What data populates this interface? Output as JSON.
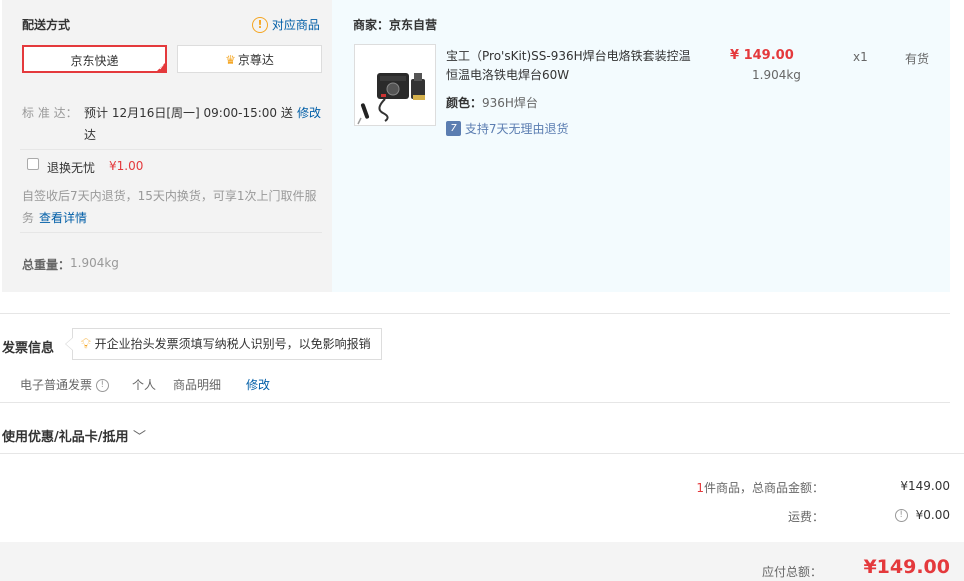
{
  "shipping": {
    "title": "配送方式",
    "corresponding_goods": "对应商品",
    "option_jd_express": "京东快递",
    "option_jzd": "京尊达",
    "std_label": "标 准 达：",
    "std_time_line1": "预计 12月16日[周一] 09:00-15:00 送",
    "std_time_line2": "达",
    "modify": "修改",
    "worry_free_label": "退换无忧",
    "worry_free_price": "¥1.00",
    "worry_free_desc_line1": "自签收后7天内退货，15天内换货，可享1次上门取件服",
    "worry_free_desc_line2": "务",
    "view_details": "查看详情",
    "total_weight_label": "总重量：",
    "total_weight_value": "1.904kg"
  },
  "merchant": {
    "label": "商家：京东自营",
    "product": {
      "name_line1": "宝工（Pro'sKit)SS-936H焊台电烙铁套装控温",
      "name_line2": "恒温电洛铁电焊台60W",
      "price": "¥ 149.00",
      "weight": "1.904kg",
      "quantity": "x1",
      "stock": "有货",
      "color_label": "颜色：",
      "color_value": "936H焊台",
      "return_policy": "支持7天无理由退货"
    }
  },
  "invoice": {
    "title": "发票信息",
    "tip": "开企业抬头发票须填写纳税人识别号，以免影响报销",
    "type": "电子普通发票",
    "holder": "个人",
    "content": "商品明细",
    "modify": "修改"
  },
  "coupon": {
    "title": "使用优惠/礼品卡/抵用"
  },
  "summary": {
    "count": "1",
    "count_suffix": "件商品，总商品金额：",
    "goods_amount": "¥149.00",
    "freight_label": "运费：",
    "freight_amount": "¥0.00",
    "payable_label": "应付总额：",
    "payable_amount": "¥149.00"
  },
  "colors": {
    "accent_red": "#e4393c",
    "link_blue": "#005ea7",
    "warn_orange": "#f5a623"
  }
}
